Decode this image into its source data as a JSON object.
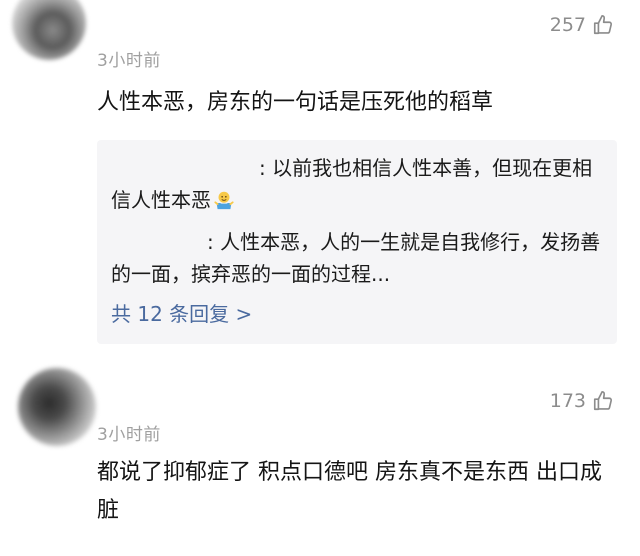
{
  "comments": [
    {
      "time": "3小时前",
      "likes": "257",
      "text": "人性本恶，房东的一句话是压死他的稻草",
      "replies": [
        {
          "text": ": 以前我也相信人性本善，但现在更相信人性本恶",
          "emoji": "shrugging-person-emoji"
        },
        {
          "text": ": 人性本恶，人的一生就是自我修行，发扬善的一面，摈弃恶的一面的过程..."
        }
      ],
      "more_replies": "共 12 条回复 >"
    },
    {
      "time": "3小时前",
      "likes": "173",
      "text": "都说了抑郁症了 积点口德吧 房东真不是东西 出口成脏"
    }
  ],
  "icons": {
    "like": "thumbs-up-outline-icon"
  },
  "colors": {
    "link": "#4a6a9f",
    "secondary_text": "#a0a0a0",
    "reply_bg": "#f5f5f7"
  }
}
